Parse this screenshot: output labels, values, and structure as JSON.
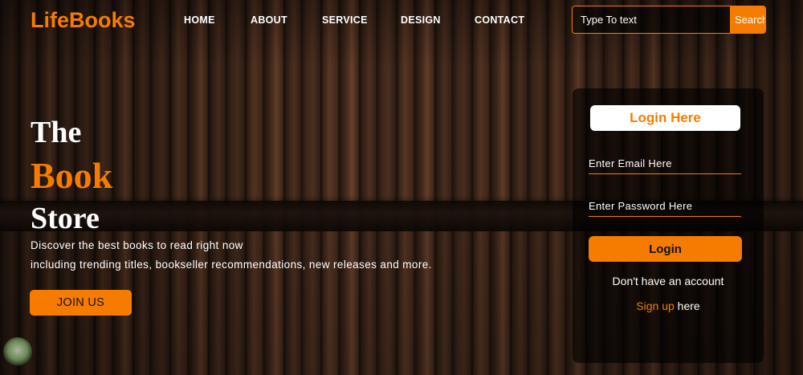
{
  "brand": {
    "name": "LifeBooks",
    "accent_color": "#f57c00"
  },
  "nav": [
    {
      "label": "HOME"
    },
    {
      "label": "ABOUT"
    },
    {
      "label": "SERVICE"
    },
    {
      "label": "DESIGN"
    },
    {
      "label": "CONTACT"
    }
  ],
  "search": {
    "placeholder": "Type To text",
    "button_label": "Search"
  },
  "hero": {
    "line1": "The",
    "line2": "Book",
    "line3": "Store",
    "desc1": "Discover the best books to read right now",
    "desc2": "including trending titles, bookseller recommendations, new releases and more.",
    "cta": "JOIN US"
  },
  "login": {
    "title": "Login Here",
    "email_placeholder": "Enter Email Here",
    "password_placeholder": "Enter Password Here",
    "button_label": "Login",
    "no_account": "Don't have an account",
    "signup_link": "Sign up",
    "signup_suffix": " here"
  }
}
